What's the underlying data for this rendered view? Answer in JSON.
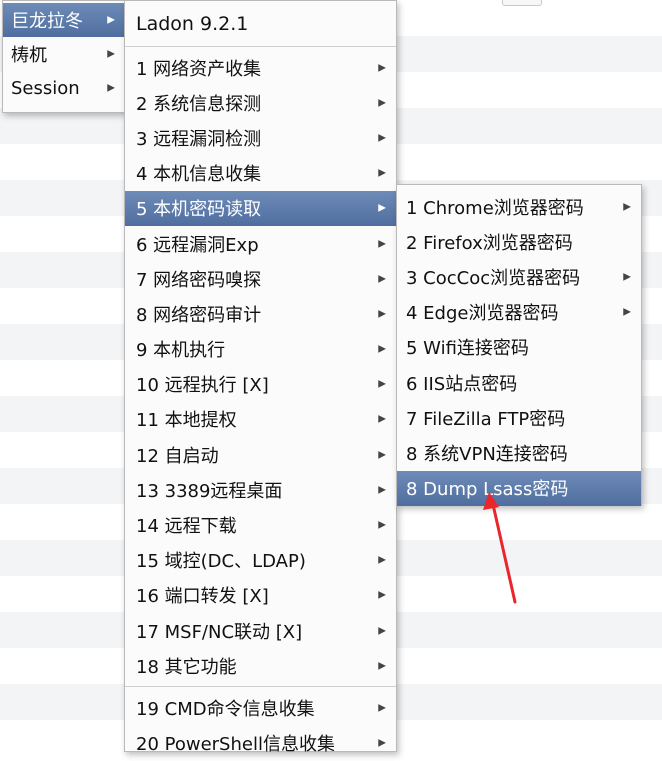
{
  "top_menu": [
    {
      "label": "巨龙拉冬",
      "selected": true
    },
    {
      "label": "梼杌",
      "selected": false
    },
    {
      "label": "Session",
      "selected": false
    }
  ],
  "ladon_menu": {
    "title": "Ladon 9.2.1",
    "items": [
      {
        "label": "1 网络资产收集"
      },
      {
        "label": "2 系统信息探测"
      },
      {
        "label": "3 远程漏洞检测"
      },
      {
        "label": "4 本机信息收集"
      },
      {
        "label": "5 本机密码读取",
        "selected": true
      },
      {
        "label": "6 远程漏洞Exp"
      },
      {
        "label": "7 网络密码嗅探"
      },
      {
        "label": "8 网络密码审计"
      },
      {
        "label": "9 本机执行"
      },
      {
        "label": "10 远程执行 [X]"
      },
      {
        "label": "11 本地提权"
      },
      {
        "label": "12 自启动"
      },
      {
        "label": "13 3389远程桌面"
      },
      {
        "label": "14 远程下载"
      },
      {
        "label": "15 域控(DC、LDAP)"
      },
      {
        "label": "16 端口转发 [X]"
      },
      {
        "label": "17 MSF/NC联动 [X]"
      },
      {
        "label": "18 其它功能"
      }
    ],
    "extra_items": [
      {
        "label": "19 CMD命令信息收集"
      },
      {
        "label": "20 PowerShell信息收集"
      }
    ]
  },
  "password_menu": [
    {
      "label": "1 Chrome浏览器密码",
      "has_submenu": true
    },
    {
      "label": "2 Firefox浏览器密码",
      "has_submenu": false
    },
    {
      "label": "3 CocCoc浏览器密码",
      "has_submenu": true
    },
    {
      "label": "4 Edge浏览器密码",
      "has_submenu": true
    },
    {
      "label": "5 Wifi连接密码",
      "has_submenu": false
    },
    {
      "label": "6 IIS站点密码",
      "has_submenu": false
    },
    {
      "label": "7 FileZilla FTP密码",
      "has_submenu": false
    },
    {
      "label": "8 系统VPN连接密码",
      "has_submenu": false
    },
    {
      "label": "8 Dump Lsass密码",
      "has_submenu": false,
      "selected": true
    }
  ],
  "icons": {
    "submenu": "chevron-right-icon",
    "annotation": "red-arrow-icon"
  },
  "colors": {
    "selection": "#5a77a8",
    "annotation_arrow": "#e8262b"
  }
}
